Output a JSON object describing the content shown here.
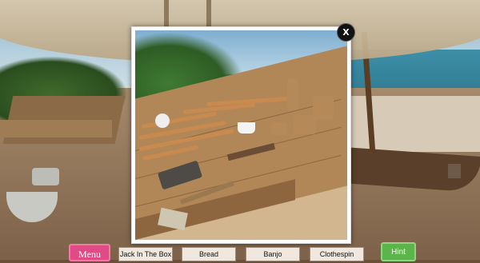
{
  "popup": {
    "close_label": "X"
  },
  "toolbar": {
    "menu_label": "Menu",
    "hint_label": "Hint",
    "items": [
      {
        "label": "Jack In The Box"
      },
      {
        "label": "Bread"
      },
      {
        "label": "Banjo"
      },
      {
        "label": "Clothespin"
      }
    ]
  },
  "colors": {
    "menu_button": "#e04b86",
    "hint_button": "#5bb54a",
    "item_slot": "#f0e8de"
  }
}
